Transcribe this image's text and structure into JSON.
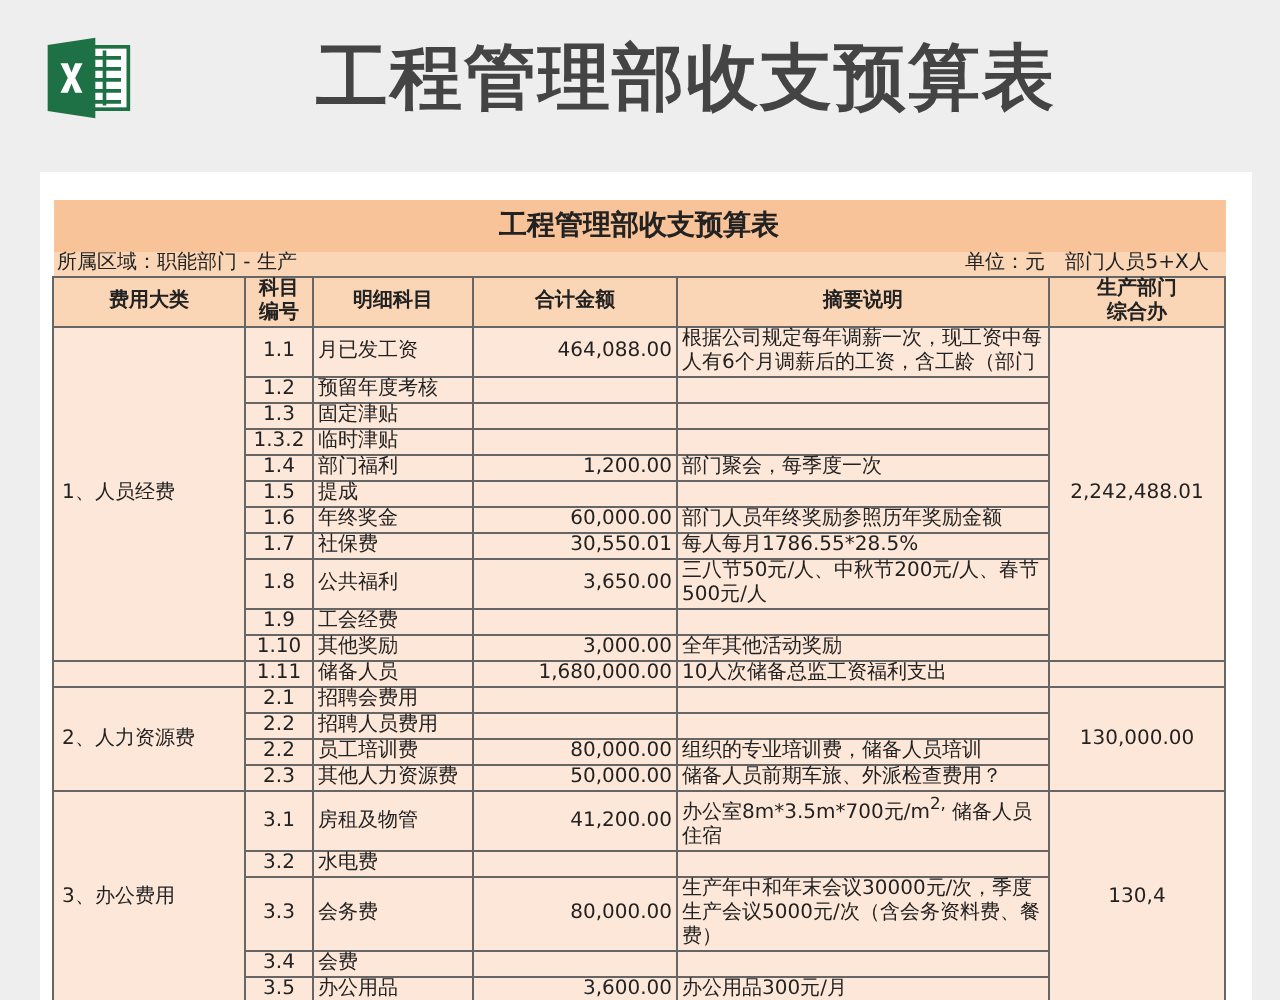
{
  "header": {
    "title": "工程管理部收支预算表"
  },
  "sheet": {
    "title": "工程管理部收支预算表",
    "region": "所属区域：职能部门 - 生产",
    "unit": "单位：元",
    "staff": "部门人员5+X人",
    "columns": [
      "费用大类",
      "科目编号",
      "明细科目",
      "合计金额",
      "摘要说明"
    ],
    "dept_column": [
      "生产部门",
      "综合办"
    ],
    "groups": [
      {
        "category": "1、人员经费",
        "total": "2,242,488.01",
        "rows": [
          {
            "code": "1.1",
            "item": "月已发工资",
            "amount": "464,088.00",
            "note": "根据公司规定每年调薪一次，现工资中每人有6个月调薪后的工资，含工龄（部门"
          },
          {
            "code": "1.2",
            "item": "预留年度考核"
          },
          {
            "code": "1.3",
            "item": "固定津贴"
          },
          {
            "code": "1.3.2",
            "item": "临时津贴"
          },
          {
            "code": "1.4",
            "item": "部门福利",
            "amount": "1,200.00",
            "note": "部门聚会，每季度一次"
          },
          {
            "code": "1.5",
            "item": "提成"
          },
          {
            "code": "1.6",
            "item": "年终奖金",
            "amount": "60,000.00",
            "note": "部门人员年终奖励参照历年奖励金额"
          },
          {
            "code": "1.7",
            "item": "社保费",
            "amount": "30,550.01",
            "note": "每人每月1786.55*28.5%"
          },
          {
            "code": "1.8",
            "item": "公共福利",
            "amount": "3,650.00",
            "note": "三八节50元/人、中秋节200元/人、春节500元/人"
          },
          {
            "code": "1.9",
            "item": "工会经费"
          },
          {
            "code": "1.10",
            "item": "其他奖励",
            "amount": "3,000.00",
            "note": "全年其他活动奖励"
          }
        ]
      },
      {
        "rows": [
          {
            "code": "1.11",
            "item": "储备人员",
            "amount": "1,680,000.00",
            "note": "10人次储备总监工资福利支出"
          }
        ]
      },
      {
        "category": "2、人力资源费",
        "total": "130,000.00",
        "rows": [
          {
            "code": "2.1",
            "item": "招聘会费用"
          },
          {
            "code": "2.2",
            "item": "招聘人员费用"
          },
          {
            "code": "2.2",
            "item": "员工培训费",
            "amount": "80,000.00",
            "note": "组织的专业培训费，储备人员培训"
          },
          {
            "code": "2.3",
            "item": "其他人力资源费",
            "amount": "50,000.00",
            "note": "储备人员前期车旅、外派检查费用？"
          }
        ]
      },
      {
        "category": "3、办公费用",
        "total": "130,4",
        "rows": [
          {
            "code": "3.1",
            "item": "房租及物管",
            "amount": "41,200.00",
            "note": "办公室8m*3.5m*700元/m$^{2,}$ 储备人员住宿"
          },
          {
            "code": "3.2",
            "item": "水电费"
          },
          {
            "code": "3.3",
            "item": "会务费",
            "amount": "80,000.00",
            "note": "生产年中和年末会议30000元/次，季度生产会议5000元/次（含会务资料费、餐费）"
          },
          {
            "code": "3.4",
            "item": "会费"
          },
          {
            "code": "3.5",
            "item": "办公用品",
            "amount": "3,600.00",
            "note": "办公用品300元/月"
          }
        ]
      }
    ]
  }
}
